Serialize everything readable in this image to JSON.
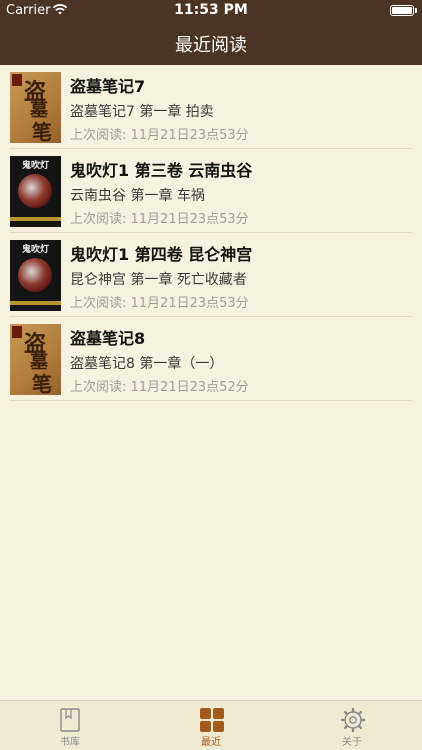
{
  "status": {
    "carrier": "Carrier",
    "time": "11:53 PM",
    "wifi_icon": "wifi-icon",
    "battery_icon": "battery-icon"
  },
  "nav": {
    "title": "最近阅读"
  },
  "books": [
    {
      "title": "盗墓笔记7",
      "chapter": "盗墓笔记7 第一章 拍卖",
      "last_read": "上次阅读: 11月21日23点53分",
      "cover": "tomb"
    },
    {
      "title": "鬼吹灯1 第三卷 云南虫谷",
      "chapter": "云南虫谷 第一章 车祸",
      "last_read": "上次阅读: 11月21日23点53分",
      "cover": "ghost"
    },
    {
      "title": "鬼吹灯1 第四卷 昆仑神宫",
      "chapter": "昆仑神宫 第一章 死亡收藏者",
      "last_read": "上次阅读: 11月21日23点53分",
      "cover": "ghost"
    },
    {
      "title": "盗墓笔记8",
      "chapter": "盗墓笔记8 第一章（一）",
      "last_read": "上次阅读: 11月21日23点52分",
      "cover": "tomb"
    }
  ],
  "tabs": [
    {
      "label": "书库",
      "icon": "book-icon",
      "active": false
    },
    {
      "label": "最近",
      "icon": "grid-icon",
      "active": true
    },
    {
      "label": "关于",
      "icon": "gear-icon",
      "active": false
    }
  ],
  "colors": {
    "header": "#4b3424",
    "background": "#f6f2df",
    "accent": "#a15a1c",
    "tab_inactive": "#8a8a8a"
  }
}
